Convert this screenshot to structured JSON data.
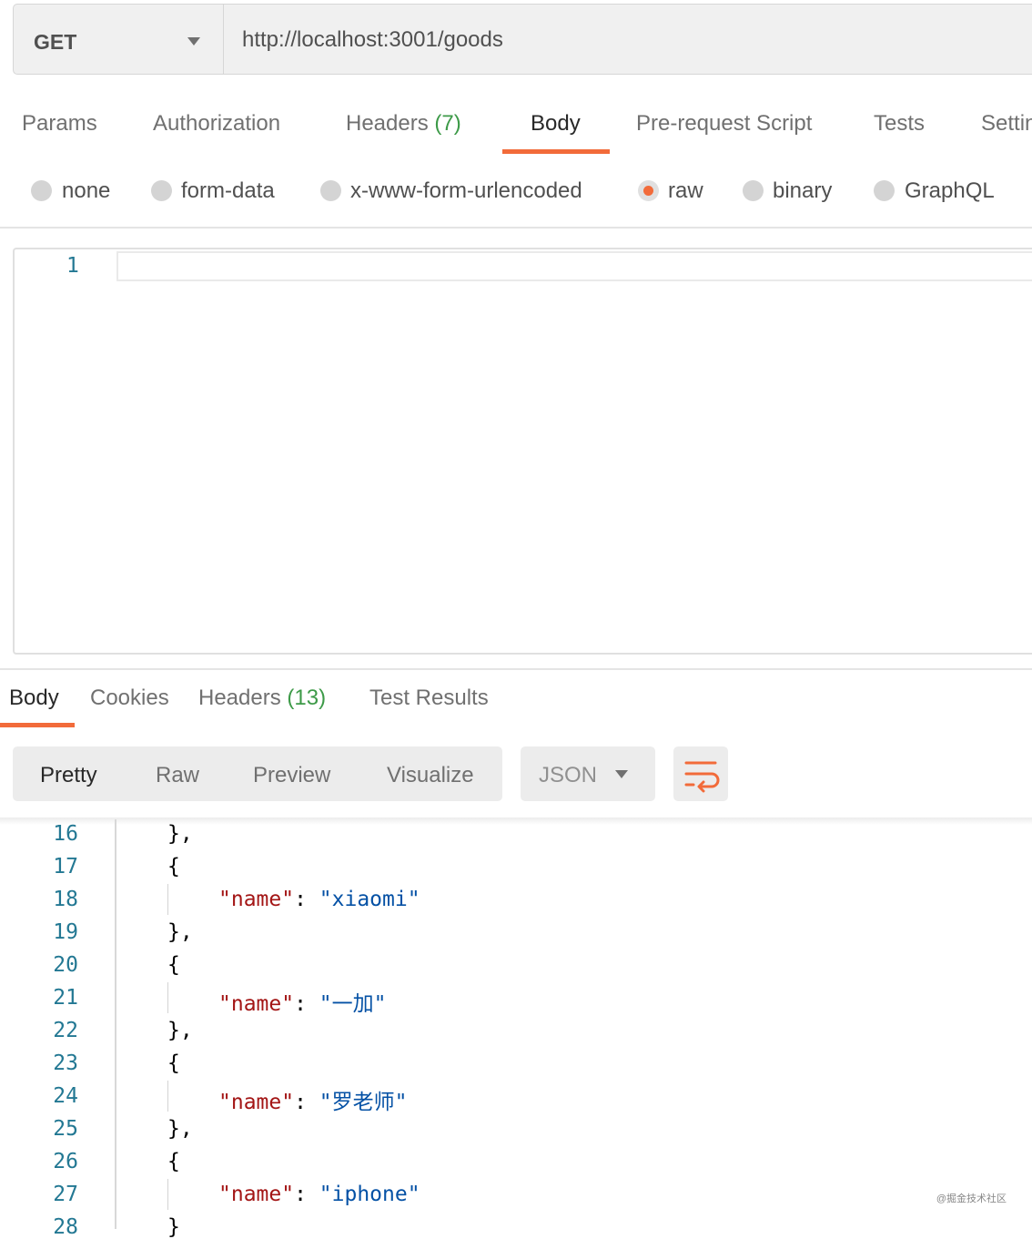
{
  "request": {
    "method": "GET",
    "url": "http://localhost:3001/goods"
  },
  "request_tabs": [
    {
      "label": "Params"
    },
    {
      "label": "Authorization"
    },
    {
      "label": "Headers",
      "count": "(7)"
    },
    {
      "label": "Body"
    },
    {
      "label": "Pre-request Script"
    },
    {
      "label": "Tests"
    },
    {
      "label": "Settin"
    }
  ],
  "body_types": [
    {
      "label": "none"
    },
    {
      "label": "form-data"
    },
    {
      "label": "x-www-form-urlencoded"
    },
    {
      "label": "raw"
    },
    {
      "label": "binary"
    },
    {
      "label": "GraphQL"
    }
  ],
  "editor": {
    "line": "1"
  },
  "response_tabs": [
    {
      "label": "Body"
    },
    {
      "label": "Cookies"
    },
    {
      "label": "Headers",
      "count": "(13)"
    },
    {
      "label": "Test Results"
    }
  ],
  "view_modes": [
    "Pretty",
    "Raw",
    "Preview",
    "Visualize"
  ],
  "format": "JSON",
  "code_lines": [
    {
      "no": "16",
      "text": "},"
    },
    {
      "no": "17",
      "text": "{"
    },
    {
      "no": "18",
      "key": "\"name\"",
      "sep": ": ",
      "val": "\"xiaomi\""
    },
    {
      "no": "19",
      "text": "},"
    },
    {
      "no": "20",
      "text": "{"
    },
    {
      "no": "21",
      "key": "\"name\"",
      "sep": ": ",
      "val": "\"一加\""
    },
    {
      "no": "22",
      "text": "},"
    },
    {
      "no": "23",
      "text": "{"
    },
    {
      "no": "24",
      "key": "\"name\"",
      "sep": ": ",
      "val": "\"罗老师\""
    },
    {
      "no": "25",
      "text": "},"
    },
    {
      "no": "26",
      "text": "{"
    },
    {
      "no": "27",
      "key": "\"name\"",
      "sep": ": ",
      "val": "\"iphone\""
    },
    {
      "no": "28",
      "text": "}"
    }
  ],
  "watermark": "@掘金技术社区",
  "colors": {
    "accent": "#f26b3a",
    "count_green": "#3d9a48",
    "line_number": "#237893",
    "json_key": "#a31515",
    "json_string": "#0451a5"
  }
}
